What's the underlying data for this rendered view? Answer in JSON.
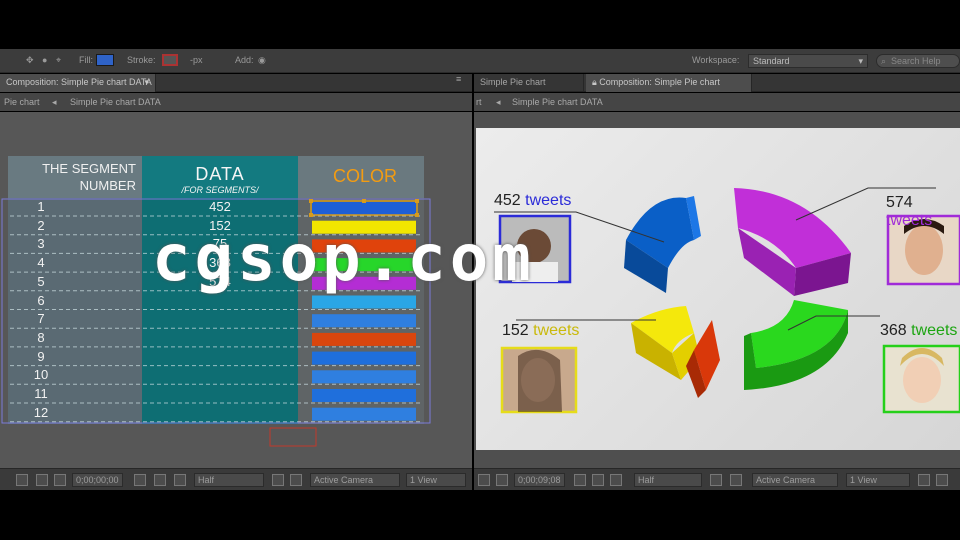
{
  "toolbar": {
    "fill_label": "Fill:",
    "stroke_label": "Stroke:",
    "stroke_width": "-px",
    "add_label": "Add:",
    "workspace_label": "Workspace:",
    "workspace_value": "Standard",
    "search_placeholder": "Search Help"
  },
  "left_panel": {
    "tab": "Composition: Simple Pie chart DATA",
    "breadcrumb": [
      "Pie chart",
      "Simple Pie chart DATA"
    ]
  },
  "right_panel": {
    "tab_inactive": "Simple Pie chart",
    "tab_active": "Composition: Simple Pie chart",
    "breadcrumb": [
      "rt",
      "Simple Pie chart DATA"
    ]
  },
  "table": {
    "headers": {
      "segment": [
        "THE SEGMENT",
        "NUMBER"
      ],
      "data": "DATA",
      "data_sub": "/FOR SEGMENTS/",
      "color": "COLOR"
    },
    "rows": [
      {
        "number": "1",
        "data": "452",
        "color": "#1e5fd6"
      },
      {
        "number": "2",
        "data": "152",
        "color": "#f2e600"
      },
      {
        "number": "3",
        "data": "75",
        "color": "#e0430c"
      },
      {
        "number": "4",
        "data": "368",
        "color": "#27d62a"
      },
      {
        "number": "5",
        "data": "574",
        "color": "#b42dd4"
      },
      {
        "number": "6",
        "data": "",
        "color": "#2aa6e6"
      },
      {
        "number": "7",
        "data": "",
        "color": "#2f7fe0"
      },
      {
        "number": "8",
        "data": "",
        "color": "#d9460e"
      },
      {
        "number": "9",
        "data": "",
        "color": "#1f6fdc"
      },
      {
        "number": "10",
        "data": "",
        "color": "#2f7fe0"
      },
      {
        "number": "11",
        "data": "",
        "color": "#1f6fdc"
      },
      {
        "number": "12",
        "data": "",
        "color": "#2f7fe0"
      }
    ]
  },
  "chart": {
    "labels": [
      {
        "value": "452",
        "unit": "tweets"
      },
      {
        "value": "152",
        "unit": "tweets"
      },
      {
        "value": "574",
        "unit": "tweets"
      },
      {
        "value": "368",
        "unit": "tweets"
      }
    ]
  },
  "viewer_left": {
    "timecode": "0;00;00;00",
    "resolution": "Half",
    "camera": "Active Camera",
    "views": "1 View"
  },
  "viewer_right": {
    "timecode": "0;00;09;08",
    "resolution": "Half",
    "camera": "Active Camera",
    "views": "1 View"
  },
  "watermark": "cgsop.com"
}
